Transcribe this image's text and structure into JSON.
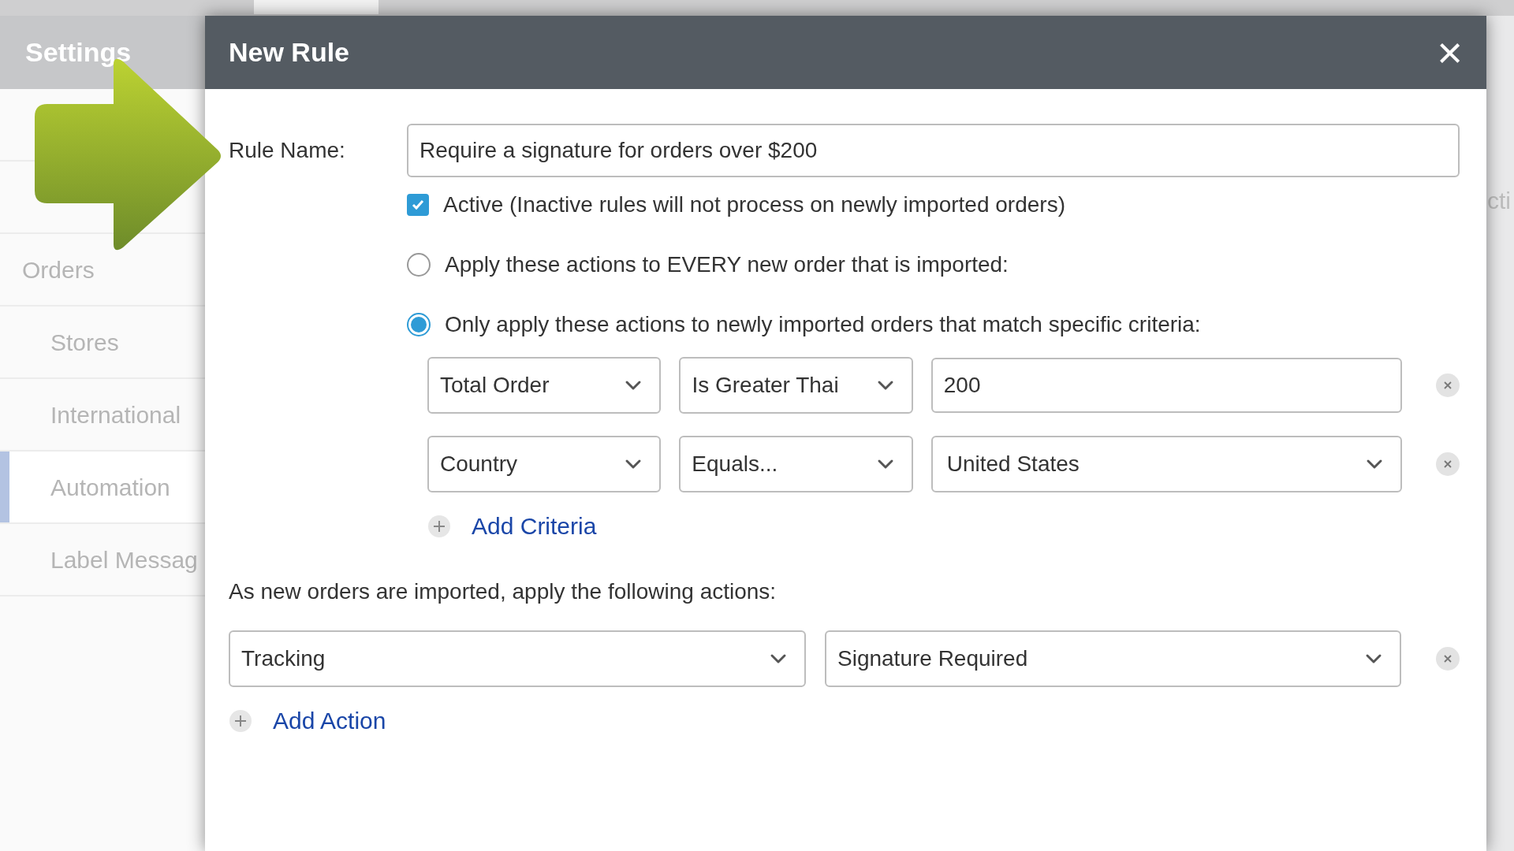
{
  "sidebar": {
    "title": "Settings",
    "items": [
      {
        "label": "Orders",
        "selected": false,
        "children": [
          {
            "label": "Stores",
            "selected": false
          },
          {
            "label": "International",
            "selected": false
          },
          {
            "label": "Automation",
            "selected": true
          },
          {
            "label": "Label Messag",
            "selected": false
          }
        ]
      }
    ]
  },
  "background_text": "cti",
  "dialog": {
    "title": "New Rule",
    "close": "×",
    "rule_name": {
      "label": "Rule Name:",
      "value": "Require a signature for orders over $200"
    },
    "active": {
      "label": "Active (Inactive rules will not process on newly imported orders)",
      "checked": true
    },
    "apply_options": [
      {
        "label": "Apply these actions to EVERY new order that is imported:",
        "selected": false
      },
      {
        "label": "Only apply these actions to newly imported orders that match specific criteria:",
        "selected": true
      }
    ],
    "criteria": [
      {
        "field": "Total Order",
        "operator": "Is Greater Thai",
        "value": "200",
        "kind": "text"
      },
      {
        "field": "Country",
        "operator": "Equals...",
        "value": "United States",
        "kind": "select"
      }
    ],
    "add_criteria": "Add Criteria",
    "actions_label": "As new orders are imported, apply the following actions:",
    "actions": [
      {
        "action": "Tracking",
        "value": "Signature Required"
      }
    ],
    "add_action": "Add Action"
  }
}
